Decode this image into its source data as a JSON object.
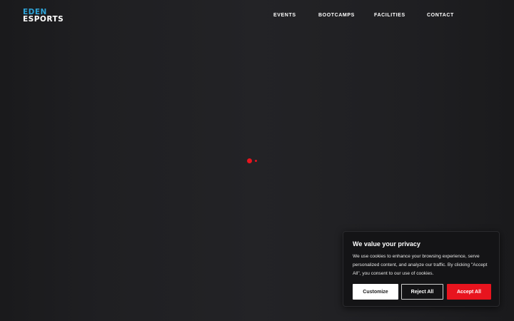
{
  "brand": {
    "line1": "EDEN",
    "line2": "ESPORTS",
    "accent_color": "#2fa4d8"
  },
  "nav": {
    "items": [
      {
        "label": "EVENTS"
      },
      {
        "label": "BOOTCAMPS"
      },
      {
        "label": "FACILITIES"
      },
      {
        "label": "CONTACT"
      }
    ]
  },
  "loader": {
    "icon": "loading-dots-icon",
    "color": "#e8141e"
  },
  "cookie_banner": {
    "title": "We value your privacy",
    "body": "We use cookies to enhance your browsing experience, serve personalized content, and analyze our traffic. By clicking \"Accept All\", you consent to our use of cookies.",
    "buttons": {
      "customize": "Customize",
      "reject": "Reject All",
      "accept": "Accept All"
    },
    "accept_color": "#e8141e"
  }
}
